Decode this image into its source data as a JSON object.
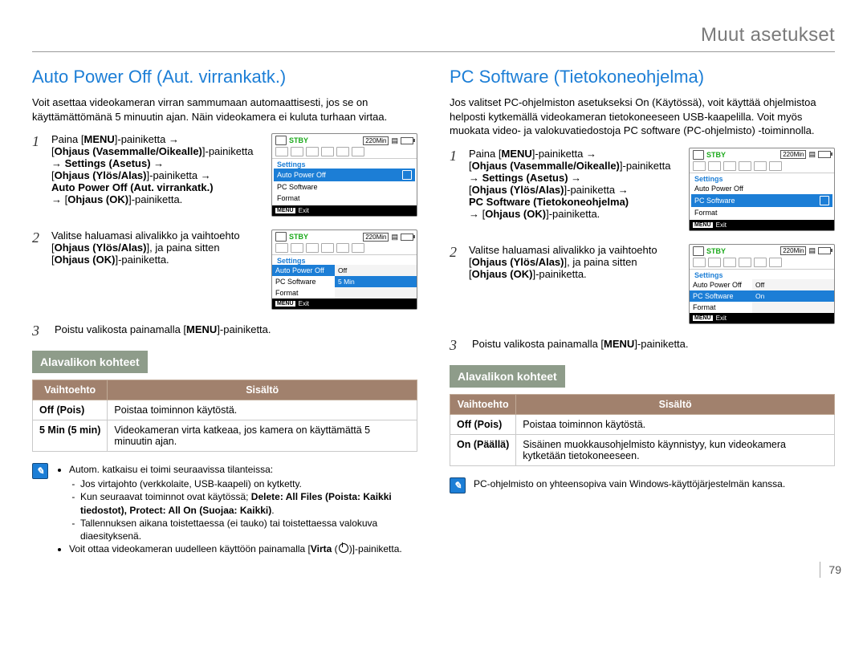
{
  "header": {
    "title": "Muut asetukset"
  },
  "page_number": "79",
  "left": {
    "title": "Auto Power Off (Aut. virrankatk.)",
    "intro": "Voit asettaa videokameran virran sammumaan automaattisesti, jos se on käyttämättömänä 5 minuutin ajan. Näin videokamera ei kuluta turhaan virtaa.",
    "steps": [
      {
        "num": "1",
        "text_pre": "Paina [",
        "menu": "MENU",
        "text_1": "]-painiketta ",
        "br1": "[",
        "b1": "Ohjaus (Vasemmalle/Oikealle)",
        "t2": "]-painiketta ",
        "b2": "Settings (Asetus)",
        "t3": " ",
        "br2": "[",
        "b3": "Ohjaus (Ylös/Alas)",
        "t4": "]-painiketta ",
        "b4": "Auto Power Off (Aut. virrankatk.)",
        "t5": " ",
        "br3": "[",
        "b5": "Ohjaus (OK)",
        "t6": "]-painiketta."
      },
      {
        "num": "2",
        "text": "Valitse haluamasi alivalikko ja vaihtoehto [",
        "b1": "Ohjaus (Ylös/Alas)",
        "t2": "], ja paina sitten [",
        "b2": "Ohjaus (OK)",
        "t3": "]-painiketta."
      },
      {
        "num": "3",
        "text": "Poistu valikosta painamalla [",
        "b1": "MENU",
        "t2": "]-painiketta."
      }
    ],
    "banner": "Alavalikon kohteet",
    "table": {
      "h1": "Vaihtoehto",
      "h2": "Sisältö",
      "rows": [
        {
          "opt": "Off (Pois)",
          "desc": "Poistaa toiminnon käytöstä."
        },
        {
          "opt": "5 Min (5 min)",
          "desc": "Videokameran virta katkeaa, jos kamera on käyttämättä 5 minuutin ajan."
        }
      ]
    },
    "note": {
      "b1": "Autom. katkaisu ei toimi seuraavissa tilanteissa:",
      "s1": "Jos virtajohto (verkkolaite, USB-kaapeli) on kytketty.",
      "s2a": "Kun seuraavat toiminnot ovat käytössä; ",
      "s2b": "Delete: All Files (Poista: Kaikki tiedostot), Protect: All On (Suojaa: Kaikki)",
      "s2c": ".",
      "s3": "Tallennuksen aikana toistettaessa (ei tauko) tai toistettaessa valokuva diaesityksenä.",
      "b2a": "Voit ottaa videokameran uudelleen käyttöön painamalla [",
      "b2b": "Virta",
      "b2c": " (",
      "b2d": ")]-painiketta."
    },
    "shot1": {
      "stby": "STBY",
      "min": "220Min",
      "label": "Settings",
      "rows": [
        "Auto Power Off",
        "PC Software",
        "Format"
      ],
      "sel": 0,
      "exit": "Exit",
      "menu": "MENU"
    },
    "shot2": {
      "stby": "STBY",
      "min": "220Min",
      "label": "Settings",
      "left": [
        "Auto Power Off",
        "PC Software",
        "Format"
      ],
      "leftSel": 0,
      "opts": [
        "Off",
        "5 Min"
      ],
      "optSel": 1,
      "exit": "Exit",
      "menu": "MENU"
    }
  },
  "right": {
    "title": "PC Software (Tietokoneohjelma)",
    "intro": "Jos valitset PC-ohjelmiston asetukseksi On (Käytössä), voit käyttää ohjelmistoa helposti kytkemällä videokameran tietokoneeseen USB-kaapelilla. Voit myös muokata video- ja valokuvatiedostoja PC software (PC-ohjelmisto) -toiminnolla.",
    "steps": [
      {
        "num": "1",
        "text_pre": "Paina [",
        "menu": "MENU",
        "text_1": "]-painiketta ",
        "br1": "[",
        "b1": "Ohjaus (Vasemmalle/Oikealle)",
        "t2": "]-painiketta ",
        "b2": "Settings (Asetus)",
        "t3": " ",
        "br2": "[",
        "b3": "Ohjaus (Ylös/Alas)",
        "t4": "]-painiketta ",
        "b4": "PC Software (Tietokoneohjelma)",
        "t5": " ",
        "br3": "[",
        "b5": "Ohjaus (OK)",
        "t6": "]-painiketta."
      },
      {
        "num": "2",
        "text": "Valitse haluamasi alivalikko ja vaihtoehto [",
        "b1": "Ohjaus (Ylös/Alas)",
        "t2": "], ja paina sitten [",
        "b2": "Ohjaus (OK)",
        "t3": "]-painiketta."
      },
      {
        "num": "3",
        "text": "Poistu valikosta painamalla [",
        "b1": "MENU",
        "t2": "]-painiketta."
      }
    ],
    "banner": "Alavalikon kohteet",
    "table": {
      "h1": "Vaihtoehto",
      "h2": "Sisältö",
      "rows": [
        {
          "opt": "Off (Pois)",
          "desc": "Poistaa toiminnon käytöstä."
        },
        {
          "opt": "On (Päällä)",
          "desc": "Sisäinen muokkausohjelmisto käynnistyy, kun videokamera kytketään tietokoneeseen."
        }
      ]
    },
    "note": {
      "text": "PC-ohjelmisto on yhteensopiva vain Windows-käyttöjärjestelmän kanssa."
    },
    "shot1": {
      "stby": "STBY",
      "min": "220Min",
      "label": "Settings",
      "rows": [
        "Auto Power Off",
        "PC Software",
        "Format"
      ],
      "sel": 1,
      "exit": "Exit",
      "menu": "MENU"
    },
    "shot2": {
      "stby": "STBY",
      "min": "220Min",
      "label": "Settings",
      "left": [
        "Auto Power Off",
        "PC Software",
        "Format"
      ],
      "leftSel": 1,
      "opts": [
        "Off",
        "On"
      ],
      "optSel": 1,
      "exit": "Exit",
      "menu": "MENU"
    }
  }
}
